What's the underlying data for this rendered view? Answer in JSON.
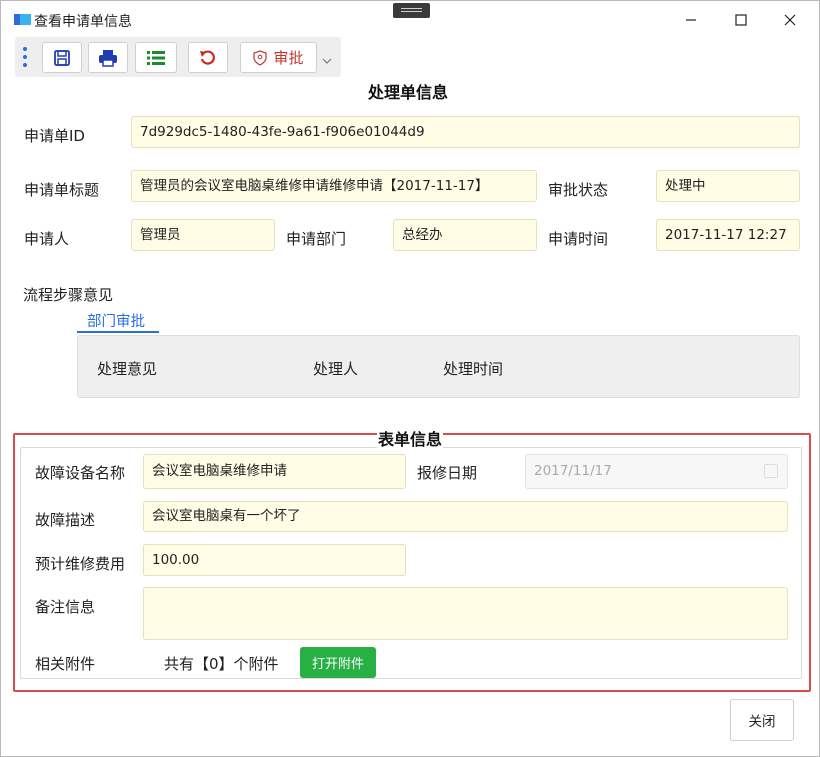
{
  "window": {
    "title": "查看申请单信息"
  },
  "toolbar": {
    "approve_label": "审批"
  },
  "colors": {
    "accent": "#2a6edb",
    "field_bg": "#fffde6",
    "highlight_border": "#d94a4a",
    "open_button": "#28b045",
    "approve_text": "#c0392b"
  },
  "icons": [
    "save-icon",
    "print-icon",
    "list-icon",
    "undo-icon",
    "shield-icon",
    "chevron-down-icon",
    "minimize-icon",
    "maximize-icon",
    "close-icon"
  ],
  "process_section": {
    "title": "处理单信息",
    "id_label": "申请单ID",
    "id_value": "7d929dc5-1480-43fe-9a61-f906e01044d9",
    "subject_label": "申请单标题",
    "subject_value": "管理员的会议室电脑桌维修申请维修申请【2017-11-17】",
    "status_label": "审批状态",
    "status_value": "处理中",
    "applicant_label": "申请人",
    "applicant_value": "管理员",
    "department_label": "申请部门",
    "department_value": "总经办",
    "time_label": "申请时间",
    "time_value": "2017-11-17 12:27"
  },
  "flow": {
    "label": "流程步骤意见",
    "tab": "部门审批",
    "columns": [
      "处理意见",
      "处理人",
      "处理时间"
    ]
  },
  "form_section": {
    "title": "表单信息",
    "device_label": "故障设备名称",
    "device_value": "会议室电脑桌维修申请",
    "date_label": "报修日期",
    "date_value": "2017/11/17",
    "desc_label": "故障描述",
    "desc_value": "会议室电脑桌有一个坏了",
    "cost_label": "预计维修费用",
    "cost_value": "100.00",
    "note_label": "备注信息",
    "note_value": "",
    "attach_label": "相关附件",
    "attach_count": "共有【0】个附件",
    "open_attach_label": "打开附件"
  },
  "footer": {
    "close_label": "关闭"
  }
}
